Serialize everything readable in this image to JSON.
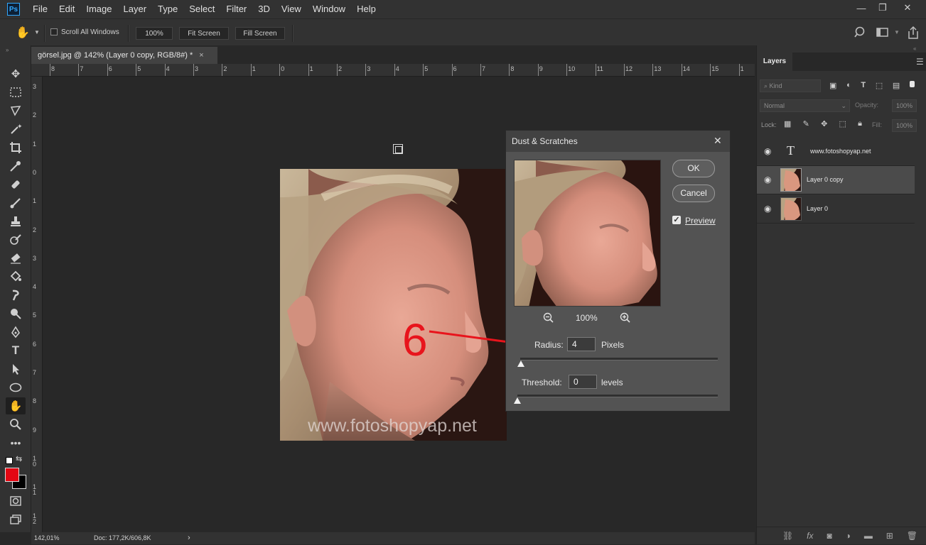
{
  "app": {
    "logo": "Ps",
    "menu": [
      "File",
      "Edit",
      "Image",
      "Layer",
      "Type",
      "Select",
      "Filter",
      "3D",
      "View",
      "Window",
      "Help"
    ],
    "window_controls": {
      "minimize": "—",
      "restore": "❐",
      "close": "✕"
    }
  },
  "options_bar": {
    "tool_icon": "hand-icon",
    "scroll_all_windows": "Scroll All Windows",
    "scroll_all_checked": false,
    "zoom_100": "100%",
    "fit_screen": "Fit Screen",
    "fill_screen": "Fill Screen"
  },
  "document": {
    "tab_title": "görsel.jpg @ 142% (Layer 0 copy, RGB/8#) *",
    "tab_close": "×",
    "ruler_top": [
      "8",
      "7",
      "6",
      "5",
      "4",
      "3",
      "2",
      "1",
      "0",
      "1",
      "2",
      "3",
      "4",
      "5",
      "6",
      "7",
      "8",
      "9",
      "10",
      "11",
      "12",
      "13",
      "14",
      "15",
      "1"
    ],
    "ruler_left": [
      "3",
      "2",
      "1",
      "0",
      "1",
      "2",
      "3",
      "4",
      "5",
      "6",
      "7",
      "8",
      "9",
      "1\n0",
      "1\n1",
      "1\n2"
    ],
    "watermark": "www.fotoshopyap.net"
  },
  "status_bar": {
    "zoom": "142,01%",
    "doc_info": "Doc: 177,2K/606,8K",
    "arrow": "›"
  },
  "annotation": {
    "number": "6",
    "arrow_color": "#e8141c"
  },
  "dialog": {
    "title": "Dust & Scratches",
    "close": "✕",
    "ok": "OK",
    "cancel": "Cancel",
    "preview_label": "Preview",
    "preview_checked": true,
    "zoom_value": "100%",
    "radius_label": "Radius:",
    "radius_value": "4",
    "radius_unit": "Pixels",
    "threshold_label": "Threshold:",
    "threshold_value": "0",
    "threshold_unit": "levels",
    "radius_slider_fraction": 0.004,
    "threshold_slider_fraction": 0.0
  },
  "colors": {
    "foreground": "#e30613",
    "background": "#000000"
  },
  "layers_panel": {
    "tab": "Layers",
    "filter_kind": "Kind",
    "blend_mode": "Normal",
    "opacity_label": "Opacity:",
    "opacity_value": "100%",
    "lock_label": "Lock:",
    "fill_label": "Fill:",
    "fill_value": "100%",
    "layers": [
      {
        "name": "www.fotoshopyap.net",
        "type": "text",
        "selected": false
      },
      {
        "name": "Layer 0 copy",
        "type": "image",
        "selected": true
      },
      {
        "name": "Layer 0",
        "type": "image",
        "selected": false
      }
    ],
    "footer_icons": [
      "link-icon",
      "fx-icon",
      "mask-icon",
      "adjustment-icon",
      "folder-icon",
      "new-layer-icon",
      "trash-icon"
    ]
  }
}
